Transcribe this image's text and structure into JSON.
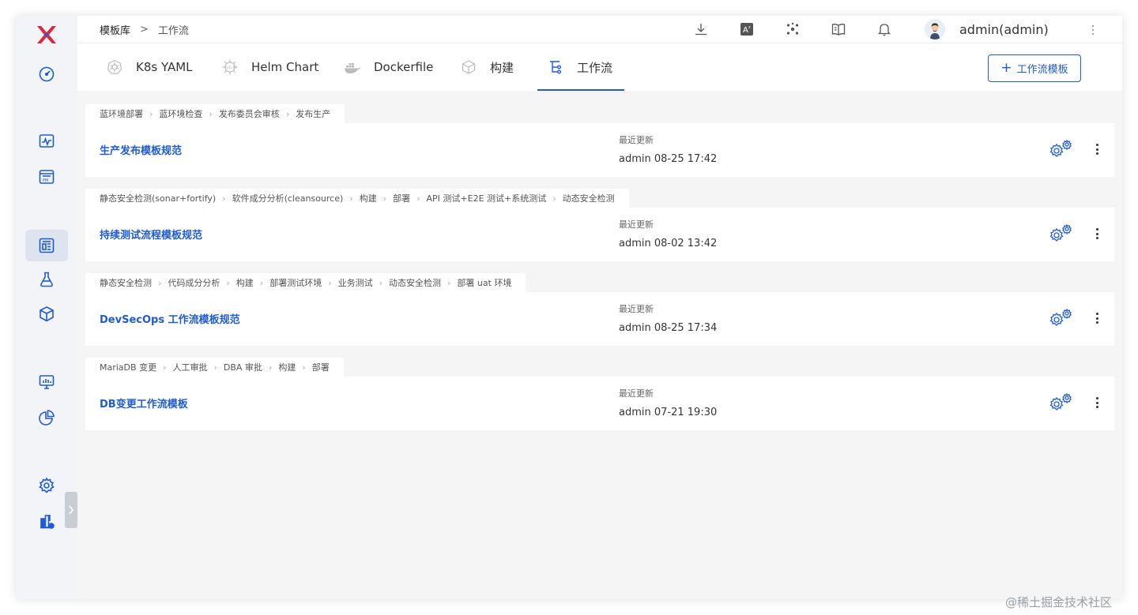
{
  "breadcrumb": {
    "root": "模板库",
    "sep": ">",
    "current": "工作流"
  },
  "header_icons": [
    "download-icon",
    "translate-icon",
    "integration-icon",
    "docs-icon",
    "bell-icon"
  ],
  "user": {
    "name": "admin(admin)"
  },
  "tabs": [
    {
      "label": "K8s YAML",
      "icon": "kubernetes-icon"
    },
    {
      "label": "Helm Chart",
      "icon": "helm-icon"
    },
    {
      "label": "Dockerfile",
      "icon": "docker-icon"
    },
    {
      "label": "构建",
      "icon": "build-icon"
    },
    {
      "label": "工作流",
      "icon": "workflow-icon",
      "active": true
    }
  ],
  "new_button": {
    "plus": "+",
    "label": "工作流模板"
  },
  "colors": {
    "accent": "#1f5bd1",
    "active_bg": "#dde3ef",
    "brand_red": "#e0283c"
  },
  "templates": [
    {
      "stages": [
        "蓝环境部署",
        "蓝环境检查",
        "发布委员会审核",
        "发布生产"
      ],
      "title": "生产发布模板规范",
      "updated_label": "最近更新",
      "updated": "admin 08-25 17:42"
    },
    {
      "stages": [
        "静态安全检测(sonar+fortify)",
        "软件成分分析(cleansource)",
        "构建",
        "部署",
        "API 测试+E2E 测试+系统测试",
        "动态安全检测"
      ],
      "title": "持续测试流程模板规范",
      "updated_label": "最近更新",
      "updated": "admin 08-02 13:42"
    },
    {
      "stages": [
        "静态安全检测",
        "代码成分分析",
        "构建",
        "部署测试环境",
        "业务测试",
        "动态安全检测",
        "部署 uat 环境"
      ],
      "title": "DevSecOps 工作流模板规范",
      "updated_label": "最近更新",
      "updated": "admin 08-25 17:34"
    },
    {
      "stages": [
        "MariaDB 变更",
        "人工审批",
        "DBA 审批",
        "构建",
        "部署"
      ],
      "title": "DB变更工作流模板",
      "updated_label": "最近更新",
      "updated": "admin 07-21 19:30"
    }
  ],
  "watermark": "@稀土掘金技术社区"
}
